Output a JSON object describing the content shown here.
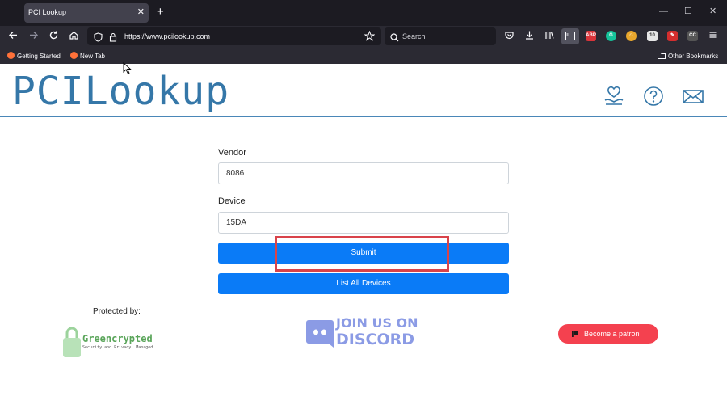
{
  "browser": {
    "tab_title": "PCI Lookup",
    "tab_close": "✕",
    "new_tab": "+",
    "window_controls": [
      "—",
      "☐",
      "✕"
    ],
    "url": "https://www.pcilookup.com",
    "search_placeholder": "Search",
    "bookmarks": [
      {
        "label": "Getting Started",
        "icon": "firefox-icon"
      },
      {
        "label": "New Tab",
        "icon": "firefox-icon"
      }
    ],
    "other_bookmarks": "Other Bookmarks",
    "extensions": [
      {
        "name": "abp-icon",
        "text": "ABP",
        "color": "#d9343a"
      },
      {
        "name": "grammarly-icon",
        "text": "G",
        "color": "#15c39a"
      },
      {
        "name": "avatar-extension-icon",
        "text": "☺",
        "color": "#e8a72d"
      },
      {
        "name": "badge-extension-icon",
        "text": "10",
        "color": "#e6e6e6"
      },
      {
        "name": "pen-extension-icon",
        "text": "✎",
        "color": "#d42e2e"
      },
      {
        "name": "cc-extension-icon",
        "text": "CC",
        "color": "#555"
      }
    ]
  },
  "site": {
    "logo": "PCILookup",
    "header_icons": [
      "donate-heart-icon",
      "help-question-icon",
      "mail-envelope-icon"
    ],
    "accent_color": "#3577a8"
  },
  "form": {
    "vendor_label": "Vendor",
    "vendor_value": "8086",
    "device_label": "Device",
    "device_value": "15DA",
    "submit_label": "Submit",
    "list_all_label": "List All Devices",
    "button_color": "#0a7bf7"
  },
  "footer": {
    "protected_by": "Protected by:",
    "greencrypted_name": "Greencrypted",
    "greencrypted_tagline": "Security and Privacy. Managed.",
    "discord_line1": "JOIN US ON",
    "discord_line2": "DISCORD",
    "patron_label": "Become a patron"
  }
}
